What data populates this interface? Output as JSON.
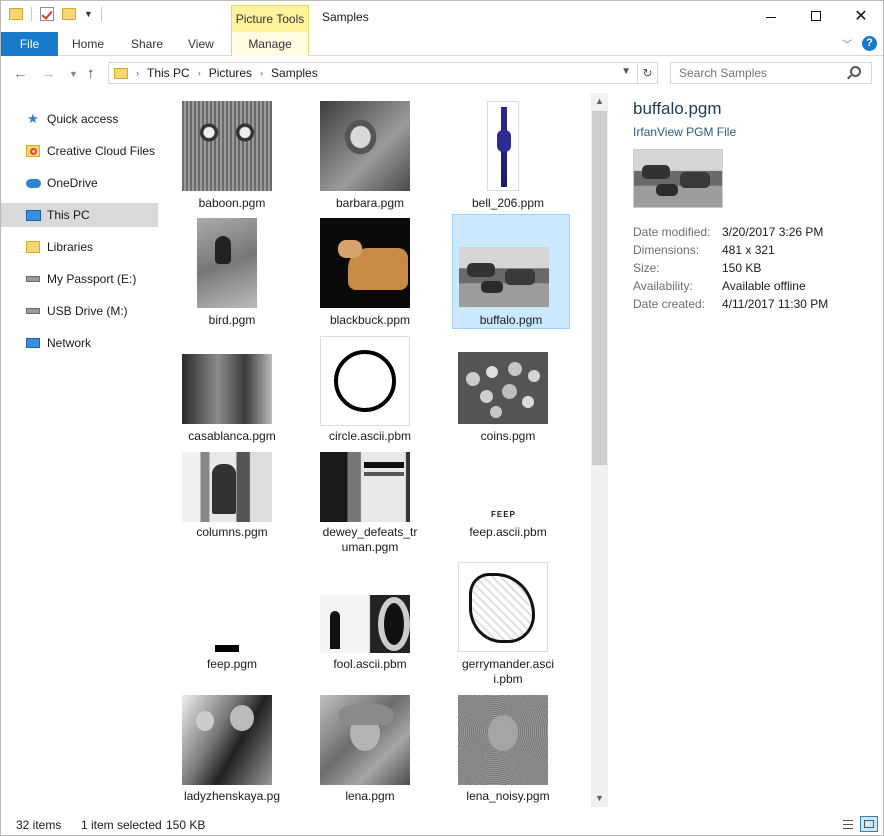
{
  "window": {
    "title": "Samples",
    "picture_tools_label": "Picture Tools",
    "controls": {
      "minimize": "—",
      "maximize": "☐",
      "close": "✕"
    }
  },
  "ribbon": {
    "file": "File",
    "home": "Home",
    "share": "Share",
    "view": "View",
    "manage": "Manage"
  },
  "address": {
    "crumbs": [
      "This PC",
      "Pictures",
      "Samples"
    ],
    "search_placeholder": "Search Samples"
  },
  "sidebar": {
    "items": [
      {
        "label": "Quick access",
        "icon": "star-icon"
      },
      {
        "label": "Creative Cloud Files",
        "icon": "creative-cloud-icon"
      },
      {
        "label": "OneDrive",
        "icon": "onedrive-icon"
      },
      {
        "label": "This PC",
        "icon": "computer-icon",
        "selected": true
      },
      {
        "label": "Libraries",
        "icon": "library-icon"
      },
      {
        "label": "My Passport (E:)",
        "icon": "drive-icon"
      },
      {
        "label": "USB Drive (M:)",
        "icon": "usb-drive-icon"
      },
      {
        "label": "Network",
        "icon": "network-icon"
      }
    ]
  },
  "files": [
    {
      "name": "baboon.pgm"
    },
    {
      "name": "barbara.pgm"
    },
    {
      "name": "bell_206.ppm"
    },
    {
      "name": "bird.pgm"
    },
    {
      "name": "blackbuck.ppm"
    },
    {
      "name": "buffalo.pgm",
      "selected": true
    },
    {
      "name": "casablanca.pgm"
    },
    {
      "name": "circle.ascii.pbm"
    },
    {
      "name": "coins.pgm"
    },
    {
      "name": "columns.pgm"
    },
    {
      "name_line1": "dewey_defeats_tr",
      "name_line2": "uman.pgm"
    },
    {
      "name": "feep.ascii.pbm",
      "thumb_text": "FEEP"
    },
    {
      "name": "feep.pgm"
    },
    {
      "name": "fool.ascii.pbm"
    },
    {
      "name_line1": "gerrymander.asci",
      "name_line2": "i.pbm"
    },
    {
      "name_line1": "ladyzhenskaya.pg",
      "name_line2": "m"
    },
    {
      "name": "lena.pgm"
    },
    {
      "name": "lena_noisy.pgm"
    }
  ],
  "details": {
    "filename": "buffalo.pgm",
    "filetype": "IrfanView PGM File",
    "rows": [
      {
        "key": "Date modified:",
        "value": "3/20/2017 3:26 PM"
      },
      {
        "key": "Dimensions:",
        "value": "481 x 321"
      },
      {
        "key": "Size:",
        "value": "150 KB"
      },
      {
        "key": "Availability:",
        "value": "Available offline"
      },
      {
        "key": "Date created:",
        "value": "4/11/2017 11:30 PM"
      }
    ]
  },
  "status": {
    "item_count": "32 items",
    "selection": "1 item selected",
    "selection_size": "150 KB"
  },
  "colors": {
    "accent": "#1979ca",
    "selection": "#cce8ff",
    "picture_tools": "#fdf39f"
  }
}
